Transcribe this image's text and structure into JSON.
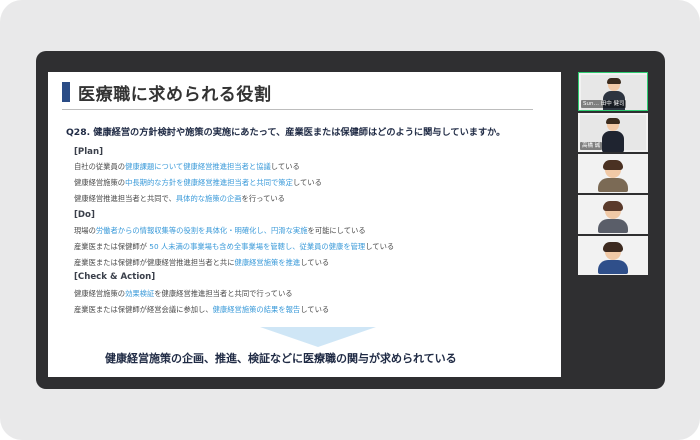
{
  "slide": {
    "title": "医療職に求められる役割",
    "question": "Q28. 健康経営の方針検討や施策の実施にあたって、産業医または保健師はどのように関与していますか。",
    "sections": [
      {
        "header": "[Plan]",
        "lines": [
          "自社の従業員の健康課題について健康経営推進担当者と協議している",
          "健康経営施策の中長期的な方針を健康経営推進担当者と共同で策定している",
          "健康経営推進担当者と共同で、具体的な施策の企画を行っている"
        ]
      },
      {
        "header": "[Do]",
        "lines": [
          "現場の労働者からの情報収集等の役割を具体化・明確化し、円滑な実施を可能にしている",
          "産業医または保健師が 50 人未満の事業場も含め全事業場を管轄し、従業員の健康を管理している",
          "産業医または保健師が健康経営推進担当者と共に健康経営施策を推進している"
        ]
      },
      {
        "header": "[Check & Action]",
        "lines": [
          "健康経営施策の効果検証を健康経営推進担当者と共同で行っている",
          "産業医または保健師が経営会議に参加し、健康経営施策の結果を報告している"
        ]
      }
    ],
    "summary": "健康経営施策の企画、推進、検証などに医療職の関与が求められている"
  },
  "participants": {
    "tiles": [
      {
        "name": "Sun…  田中 健司"
      },
      {
        "name": "高橋  誠"
      },
      {
        "name": ""
      },
      {
        "name": ""
      },
      {
        "name": ""
      }
    ]
  },
  "colors": {
    "highlight": "#3a9ad9",
    "accent": "#2a4c86",
    "active_tile": "#2ecc71"
  }
}
